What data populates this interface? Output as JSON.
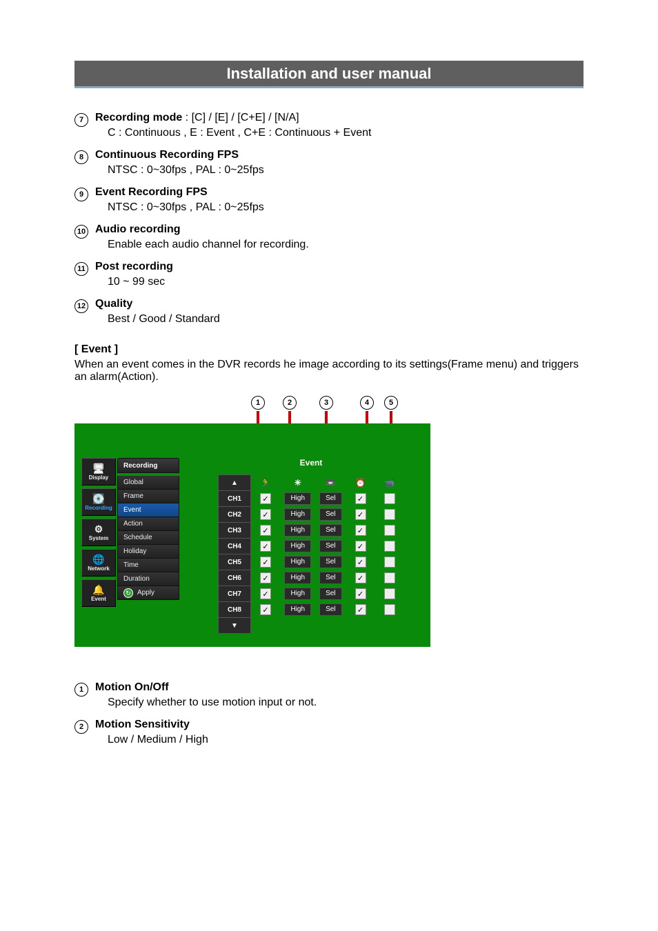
{
  "header": {
    "title": "Installation and user manual"
  },
  "items_top": [
    {
      "n": "7",
      "label": "Recording mode",
      "inline_tail": " :   [C] / [E] / [C+E] / [N/A]",
      "desc": "C : Continuous ,   E : Event ,   C+E : Continuous + Event"
    },
    {
      "n": "8",
      "label": "Continuous Recording FPS",
      "desc": "NTSC : 0~30fps ,   PAL : 0~25fps"
    },
    {
      "n": "9",
      "label": "Event Recording FPS",
      "desc": "NTSC : 0~30fps ,   PAL : 0~25fps"
    },
    {
      "n": "10",
      "label": "Audio recording",
      "desc": "Enable each audio channel for recording."
    },
    {
      "n": "11",
      "label": "Post recording",
      "desc": "10 ~ 99 sec"
    },
    {
      "n": "12",
      "label": "Quality",
      "desc": "Best / Good / Standard"
    }
  ],
  "event_section": {
    "heading": "[ Event ]",
    "para": "When an event comes in the DVR records he image according to its settings(Frame menu) and triggers an alarm(Action)."
  },
  "callouts": [
    "1",
    "2",
    "3",
    "4",
    "5"
  ],
  "dvr": {
    "nav": [
      {
        "name": "display",
        "label": "Display",
        "icon": "🖥",
        "icon_name": "monitor-icon"
      },
      {
        "name": "recording",
        "label": "Recording",
        "icon": "💽",
        "icon_name": "record-icon"
      },
      {
        "name": "system",
        "label": "System",
        "icon": "⚙",
        "icon_name": "gear-icon"
      },
      {
        "name": "network",
        "label": "Network",
        "icon": "🌐",
        "icon_name": "globe-icon"
      },
      {
        "name": "event",
        "label": "Event",
        "icon": "🔔",
        "icon_name": "bell-icon"
      }
    ],
    "menu_head": "Recording",
    "menu": [
      "Global",
      "Frame",
      "Event",
      "Action",
      "Schedule",
      "Holiday",
      "Time",
      "Duration",
      "Apply"
    ],
    "menu_selected_index": 2,
    "grid_title": "Event",
    "col_icons": [
      "▲",
      "🏃",
      "☀",
      "📼",
      "⏰",
      "📹"
    ],
    "col_icon_names": [
      "sort-up-icon",
      "motion-icon",
      "sensitivity-icon",
      "area-icon",
      "alarm-icon",
      "video-loss-icon"
    ],
    "rows": [
      {
        "ch": "CH1",
        "motion": true,
        "sens": "High",
        "area": "Sel",
        "alarm": true,
        "vloss": false
      },
      {
        "ch": "CH2",
        "motion": true,
        "sens": "High",
        "area": "Sel",
        "alarm": true,
        "vloss": false
      },
      {
        "ch": "CH3",
        "motion": true,
        "sens": "High",
        "area": "Sel",
        "alarm": true,
        "vloss": false
      },
      {
        "ch": "CH4",
        "motion": true,
        "sens": "High",
        "area": "Sel",
        "alarm": true,
        "vloss": false
      },
      {
        "ch": "CH5",
        "motion": true,
        "sens": "High",
        "area": "Sel",
        "alarm": true,
        "vloss": false
      },
      {
        "ch": "CH6",
        "motion": true,
        "sens": "High",
        "area": "Sel",
        "alarm": true,
        "vloss": false
      },
      {
        "ch": "CH7",
        "motion": true,
        "sens": "High",
        "area": "Sel",
        "alarm": true,
        "vloss": false
      },
      {
        "ch": "CH8",
        "motion": true,
        "sens": "High",
        "area": "Sel",
        "alarm": true,
        "vloss": false
      }
    ]
  },
  "items_bottom": [
    {
      "n": "1",
      "label": "Motion On/Off",
      "desc": "Specify whether to use motion input or not."
    },
    {
      "n": "2",
      "label": "Motion Sensitivity",
      "desc": "Low / Medium / High"
    }
  ]
}
